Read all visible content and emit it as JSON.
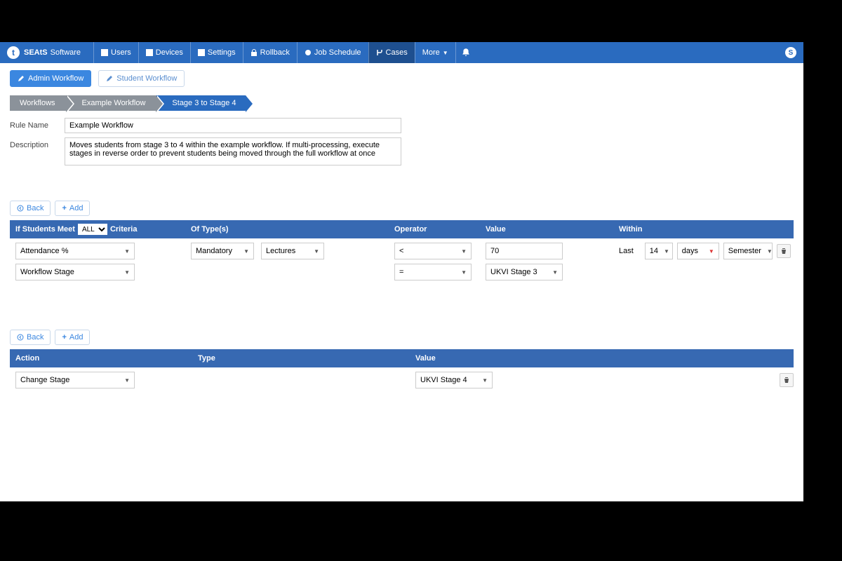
{
  "brand": {
    "logo_letter": "t",
    "name": "SEAtS",
    "sub": "Software"
  },
  "nav": {
    "users": "Users",
    "devices": "Devices",
    "settings": "Settings",
    "rollback": "Rollback",
    "job_schedule": "Job Schedule",
    "cases": "Cases",
    "more": "More",
    "right_chip": "S"
  },
  "subtabs": {
    "admin": "Admin Workflow",
    "student": "Student Workflow"
  },
  "breadcrumb": {
    "workflows": "Workflows",
    "example": "Example Workflow",
    "stage": "Stage 3 to Stage 4"
  },
  "form": {
    "rule_name_label": "Rule Name",
    "rule_name_value": "Example Workflow",
    "description_label": "Description",
    "description_value": "Moves students from stage 3 to 4 within the example workflow. If multi-processing, execute stages in reverse order to prevent students being moved through the full workflow at once"
  },
  "buttons": {
    "back": "Back",
    "add": "Add"
  },
  "criteria_header": {
    "prefix": "If Students Meet",
    "all": "ALL",
    "suffix": "Criteria",
    "of_types": "Of Type(s)",
    "operator": "Operator",
    "value": "Value",
    "within": "Within"
  },
  "criteria_rows": {
    "row1": {
      "field": "Attendance %",
      "type1": "Mandatory",
      "type2": "Lectures",
      "op": "<",
      "value": "70",
      "last": "Last",
      "qty": "14",
      "unit": "days",
      "period": "Semester"
    },
    "row2": {
      "field": "Workflow Stage",
      "op": "=",
      "value": "UKVI Stage 3"
    }
  },
  "action_header": {
    "action": "Action",
    "type": "Type",
    "value": "Value"
  },
  "action_row": {
    "action": "Change Stage",
    "value": "UKVI Stage 4"
  }
}
